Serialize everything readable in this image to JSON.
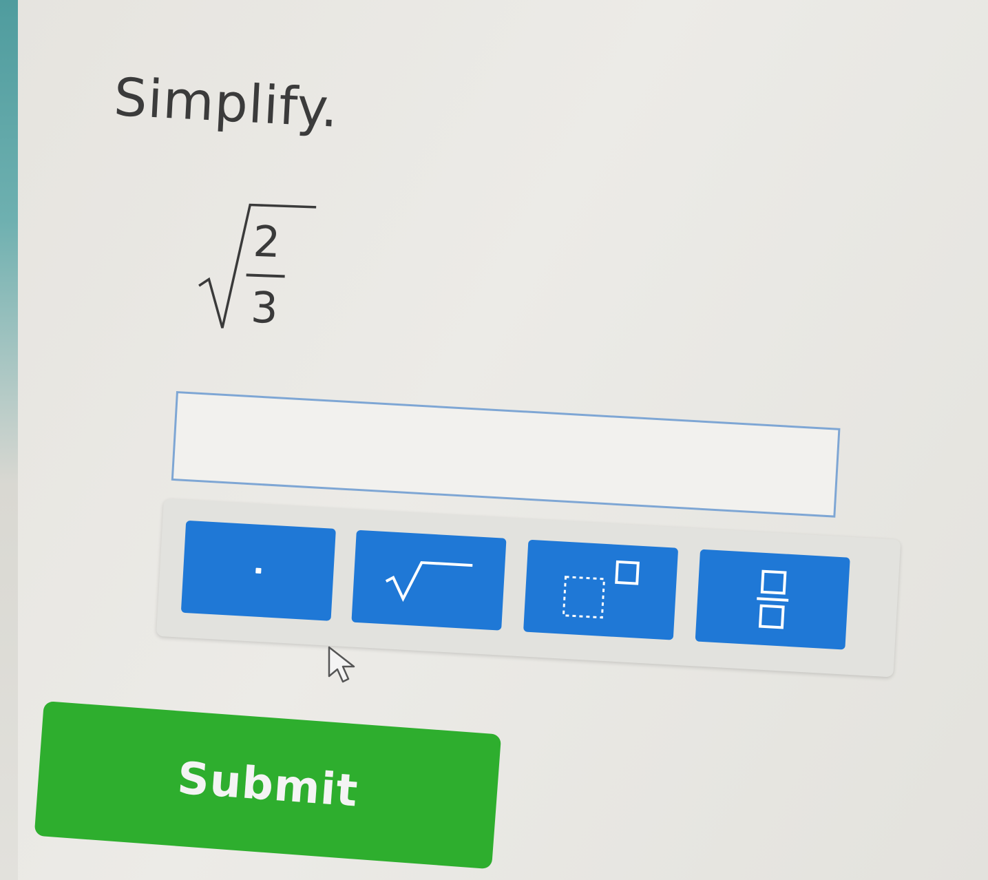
{
  "question": {
    "prompt": "Simplify.",
    "expression": {
      "numerator": "2",
      "denominator": "3"
    }
  },
  "answer_input": {
    "value": "",
    "placeholder": ""
  },
  "keypad": {
    "keys": [
      {
        "name": "decimal-point",
        "icon": "dot-icon"
      },
      {
        "name": "square-root",
        "icon": "square-root-icon"
      },
      {
        "name": "exponent",
        "icon": "exponent-icon"
      },
      {
        "name": "fraction",
        "icon": "fraction-icon"
      }
    ]
  },
  "submit": {
    "label": "Submit"
  },
  "colors": {
    "key_blue": "#1f78d6",
    "submit_green": "#2eae2e",
    "input_border": "#7ea6d4",
    "text_dark": "#3b3b3b"
  }
}
